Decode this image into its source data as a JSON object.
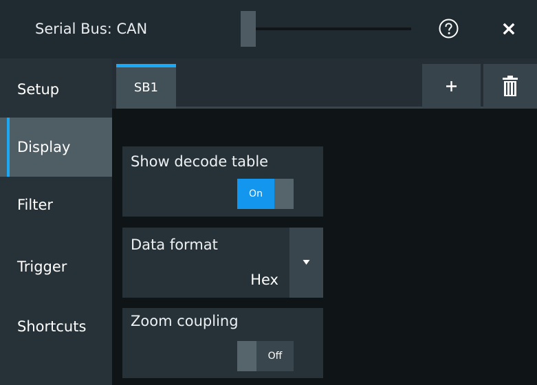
{
  "dialog": {
    "title": "Serial Bus: CAN",
    "help_icon": "help-circle-icon",
    "close_icon": "close-icon"
  },
  "sidebar": {
    "items": [
      {
        "label": "Setup",
        "active": false
      },
      {
        "label": "Display",
        "active": true
      },
      {
        "label": "Filter",
        "active": false
      },
      {
        "label": "Trigger",
        "active": false
      },
      {
        "label": "Shortcuts",
        "active": false
      }
    ]
  },
  "tabs": {
    "items": [
      {
        "label": "SB1",
        "active": true
      }
    ],
    "add_icon": "plus-icon",
    "delete_icon": "trash-icon"
  },
  "settings": {
    "show_decode_table": {
      "label": "Show decode table",
      "state": "On"
    },
    "data_format": {
      "label": "Data format",
      "value": "Hex"
    },
    "zoom_coupling": {
      "label": "Zoom coupling",
      "state": "Off"
    }
  },
  "colors": {
    "accent": "#1ba9f5",
    "toggle_on": "#1396ed"
  }
}
